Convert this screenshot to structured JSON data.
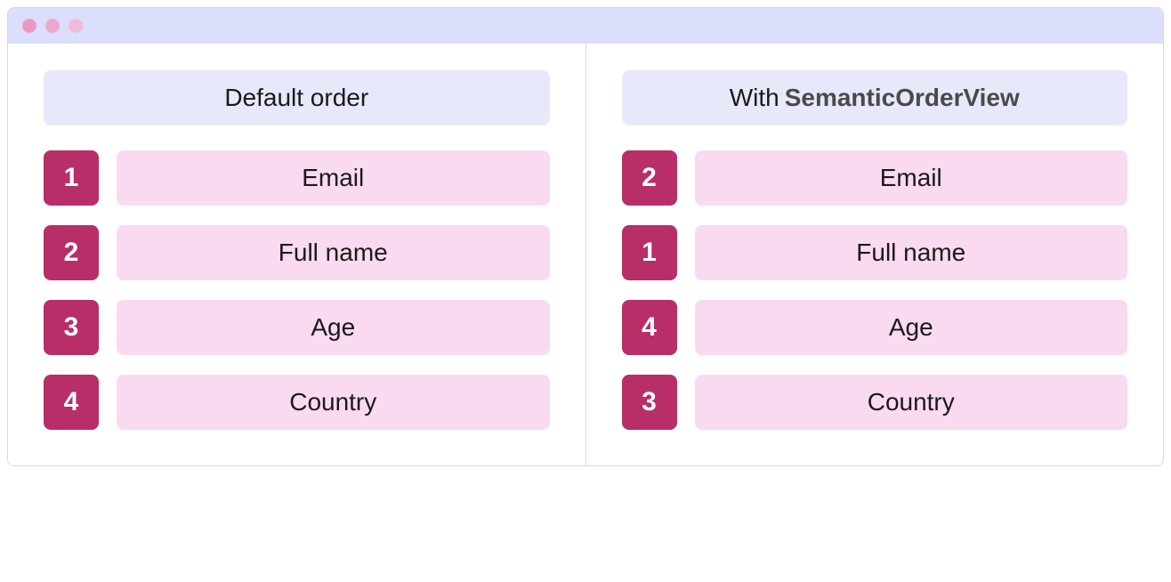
{
  "left": {
    "title": "Default order",
    "rows": [
      {
        "num": "1",
        "label": "Email"
      },
      {
        "num": "2",
        "label": "Full name"
      },
      {
        "num": "3",
        "label": "Age"
      },
      {
        "num": "4",
        "label": "Country"
      }
    ]
  },
  "right": {
    "title_prefix": "With",
    "title_bold": "SemanticOrderView",
    "rows": [
      {
        "num": "2",
        "label": "Email"
      },
      {
        "num": "1",
        "label": "Full name"
      },
      {
        "num": "4",
        "label": "Age"
      },
      {
        "num": "3",
        "label": "Country"
      }
    ]
  }
}
